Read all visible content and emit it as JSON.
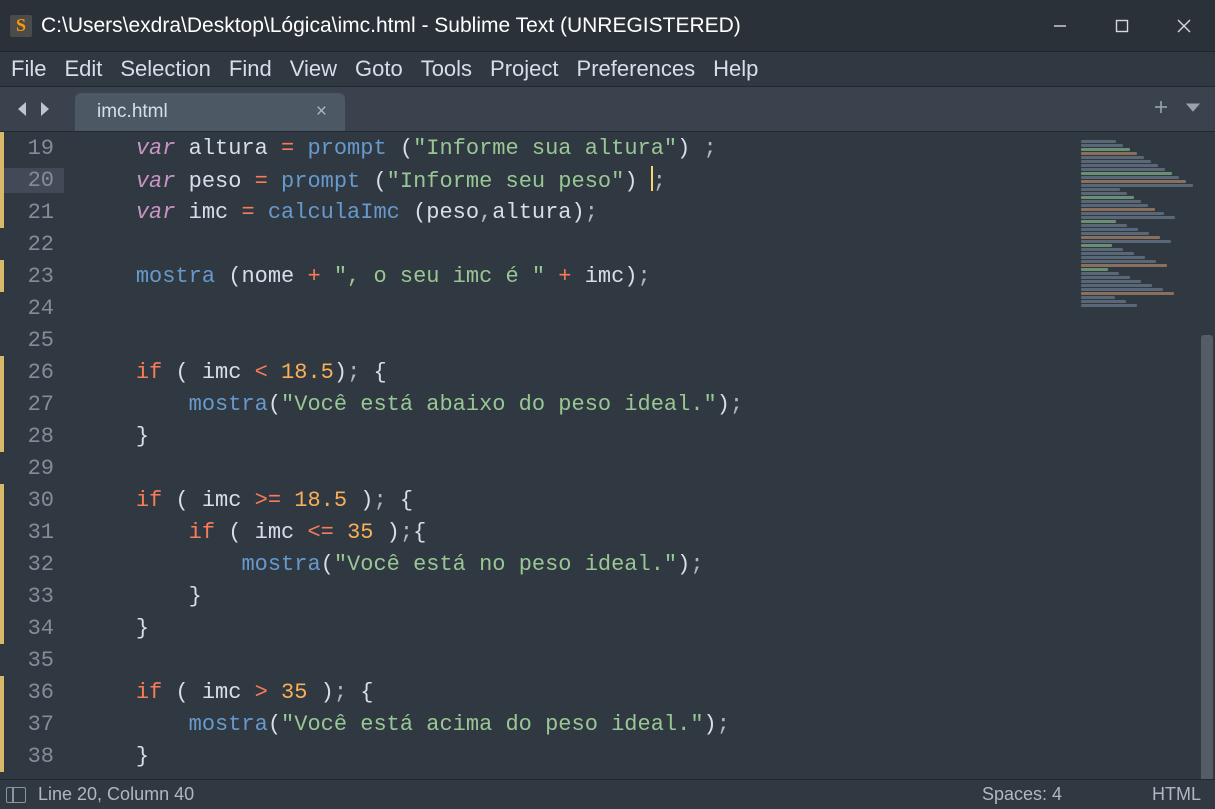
{
  "window": {
    "title": "C:\\Users\\exdra\\Desktop\\Lógica\\imc.html - Sublime Text (UNREGISTERED)"
  },
  "menu": {
    "items": [
      "File",
      "Edit",
      "Selection",
      "Find",
      "View",
      "Goto",
      "Tools",
      "Project",
      "Preferences",
      "Help"
    ]
  },
  "tab": {
    "name": "imc.html"
  },
  "status": {
    "position": "Line 20, Column 40",
    "spaces": "Spaces: 4",
    "syntax": "HTML"
  },
  "editor": {
    "first_line": 19,
    "highlighted_line": 20,
    "modified_lines": [
      19,
      20,
      21,
      23,
      26,
      27,
      28,
      30,
      31,
      32,
      33,
      34,
      36,
      37,
      38
    ],
    "fold_lines": [
      26,
      27,
      30,
      31,
      32,
      36,
      37
    ],
    "lines": [
      {
        "n": 19,
        "tokens": [
          {
            "t": "    ",
            "c": "var"
          },
          {
            "t": "var",
            "c": "kw"
          },
          {
            "t": " ",
            "c": "var"
          },
          {
            "t": "altura",
            "c": "var"
          },
          {
            "t": " ",
            "c": "var"
          },
          {
            "t": "=",
            "c": "op"
          },
          {
            "t": " ",
            "c": "var"
          },
          {
            "t": "prompt",
            "c": "fn"
          },
          {
            "t": " ",
            "c": "var"
          },
          {
            "t": "(",
            "c": "paren"
          },
          {
            "t": "\"Informe sua altura\"",
            "c": "str"
          },
          {
            "t": ")",
            "c": "paren"
          },
          {
            "t": " ;",
            "c": "punc"
          }
        ]
      },
      {
        "n": 20,
        "tokens": [
          {
            "t": "    ",
            "c": "var"
          },
          {
            "t": "var",
            "c": "kw"
          },
          {
            "t": " ",
            "c": "var"
          },
          {
            "t": "peso",
            "c": "var"
          },
          {
            "t": " ",
            "c": "var"
          },
          {
            "t": "=",
            "c": "op"
          },
          {
            "t": " ",
            "c": "var"
          },
          {
            "t": "prompt",
            "c": "fn"
          },
          {
            "t": " ",
            "c": "var"
          },
          {
            "t": "(",
            "c": "paren"
          },
          {
            "t": "\"Informe seu peso\"",
            "c": "str"
          },
          {
            "t": ")",
            "c": "paren"
          },
          {
            "t": " ",
            "c": "var"
          },
          {
            "t": "CURSOR",
            "c": "cursor"
          },
          {
            "t": ";",
            "c": "punc"
          }
        ]
      },
      {
        "n": 21,
        "tokens": [
          {
            "t": "    ",
            "c": "var"
          },
          {
            "t": "var",
            "c": "kw"
          },
          {
            "t": " ",
            "c": "var"
          },
          {
            "t": "imc",
            "c": "var"
          },
          {
            "t": " ",
            "c": "var"
          },
          {
            "t": "=",
            "c": "op"
          },
          {
            "t": " ",
            "c": "var"
          },
          {
            "t": "calculaImc",
            "c": "fn"
          },
          {
            "t": " ",
            "c": "var"
          },
          {
            "t": "(",
            "c": "paren"
          },
          {
            "t": "peso",
            "c": "var"
          },
          {
            "t": ",",
            "c": "punc"
          },
          {
            "t": "altura",
            "c": "var"
          },
          {
            "t": ")",
            "c": "paren"
          },
          {
            "t": ";",
            "c": "punc"
          }
        ]
      },
      {
        "n": 22,
        "tokens": []
      },
      {
        "n": 23,
        "tokens": [
          {
            "t": "    ",
            "c": "var"
          },
          {
            "t": "mostra",
            "c": "fn"
          },
          {
            "t": " ",
            "c": "var"
          },
          {
            "t": "(",
            "c": "paren"
          },
          {
            "t": "nome",
            "c": "var"
          },
          {
            "t": " ",
            "c": "var"
          },
          {
            "t": "+",
            "c": "op"
          },
          {
            "t": " ",
            "c": "var"
          },
          {
            "t": "\", o seu imc é \"",
            "c": "str"
          },
          {
            "t": " ",
            "c": "var"
          },
          {
            "t": "+",
            "c": "op"
          },
          {
            "t": " ",
            "c": "var"
          },
          {
            "t": "imc",
            "c": "var"
          },
          {
            "t": ")",
            "c": "paren"
          },
          {
            "t": ";",
            "c": "punc"
          }
        ]
      },
      {
        "n": 24,
        "tokens": [
          {
            "t": "",
            "c": "var"
          }
        ]
      },
      {
        "n": 25,
        "tokens": []
      },
      {
        "n": 26,
        "tokens": [
          {
            "t": "    ",
            "c": "var"
          },
          {
            "t": "if",
            "c": "op"
          },
          {
            "t": " ",
            "c": "var"
          },
          {
            "t": "(",
            "c": "paren"
          },
          {
            "t": " imc ",
            "c": "var"
          },
          {
            "t": "<",
            "c": "op"
          },
          {
            "t": " ",
            "c": "var"
          },
          {
            "t": "18.5",
            "c": "num"
          },
          {
            "t": ")",
            "c": "paren"
          },
          {
            "t": ";",
            "c": "punc"
          },
          {
            "t": " ",
            "c": "var"
          },
          {
            "t": "{",
            "c": "paren"
          }
        ]
      },
      {
        "n": 27,
        "tokens": [
          {
            "t": "        ",
            "c": "var"
          },
          {
            "t": "mostra",
            "c": "fn"
          },
          {
            "t": "(",
            "c": "paren"
          },
          {
            "t": "\"Você está abaixo do peso ideal.\"",
            "c": "str"
          },
          {
            "t": ")",
            "c": "paren"
          },
          {
            "t": ";",
            "c": "punc"
          }
        ]
      },
      {
        "n": 28,
        "tokens": [
          {
            "t": "    ",
            "c": "var"
          },
          {
            "t": "}",
            "c": "paren"
          }
        ]
      },
      {
        "n": 29,
        "tokens": []
      },
      {
        "n": 30,
        "tokens": [
          {
            "t": "    ",
            "c": "var"
          },
          {
            "t": "if",
            "c": "op"
          },
          {
            "t": " ",
            "c": "var"
          },
          {
            "t": "(",
            "c": "paren"
          },
          {
            "t": " imc ",
            "c": "var"
          },
          {
            "t": ">=",
            "c": "op"
          },
          {
            "t": " ",
            "c": "var"
          },
          {
            "t": "18.5",
            "c": "num"
          },
          {
            "t": " ",
            "c": "var"
          },
          {
            "t": ")",
            "c": "paren"
          },
          {
            "t": ";",
            "c": "punc"
          },
          {
            "t": " ",
            "c": "var"
          },
          {
            "t": "{",
            "c": "paren"
          }
        ]
      },
      {
        "n": 31,
        "tokens": [
          {
            "t": "        ",
            "c": "var"
          },
          {
            "t": "if",
            "c": "op"
          },
          {
            "t": " ",
            "c": "var"
          },
          {
            "t": "(",
            "c": "paren"
          },
          {
            "t": " imc ",
            "c": "var"
          },
          {
            "t": "<=",
            "c": "op"
          },
          {
            "t": " ",
            "c": "var"
          },
          {
            "t": "35",
            "c": "num"
          },
          {
            "t": " ",
            "c": "var"
          },
          {
            "t": ")",
            "c": "paren"
          },
          {
            "t": ";",
            "c": "punc"
          },
          {
            "t": "{",
            "c": "paren"
          }
        ]
      },
      {
        "n": 32,
        "tokens": [
          {
            "t": "            ",
            "c": "var"
          },
          {
            "t": "mostra",
            "c": "fn"
          },
          {
            "t": "(",
            "c": "paren"
          },
          {
            "t": "\"Você está no peso ideal.\"",
            "c": "str"
          },
          {
            "t": ")",
            "c": "paren"
          },
          {
            "t": ";",
            "c": "punc"
          }
        ]
      },
      {
        "n": 33,
        "tokens": [
          {
            "t": "        ",
            "c": "var"
          },
          {
            "t": "}",
            "c": "paren"
          }
        ]
      },
      {
        "n": 34,
        "tokens": [
          {
            "t": "    ",
            "c": "var"
          },
          {
            "t": "}",
            "c": "paren"
          }
        ]
      },
      {
        "n": 35,
        "tokens": []
      },
      {
        "n": 36,
        "tokens": [
          {
            "t": "    ",
            "c": "var"
          },
          {
            "t": "if",
            "c": "op"
          },
          {
            "t": " ",
            "c": "var"
          },
          {
            "t": "(",
            "c": "paren"
          },
          {
            "t": " imc ",
            "c": "var"
          },
          {
            "t": ">",
            "c": "op"
          },
          {
            "t": " ",
            "c": "var"
          },
          {
            "t": "35",
            "c": "num"
          },
          {
            "t": " ",
            "c": "var"
          },
          {
            "t": ")",
            "c": "paren"
          },
          {
            "t": ";",
            "c": "punc"
          },
          {
            "t": " ",
            "c": "var"
          },
          {
            "t": "{",
            "c": "paren"
          }
        ]
      },
      {
        "n": 37,
        "tokens": [
          {
            "t": "        ",
            "c": "var"
          },
          {
            "t": "mostra",
            "c": "fn"
          },
          {
            "t": "(",
            "c": "paren"
          },
          {
            "t": "\"Você está acima do peso ideal.\"",
            "c": "str"
          },
          {
            "t": ")",
            "c": "paren"
          },
          {
            "t": ";",
            "c": "punc"
          }
        ]
      },
      {
        "n": 38,
        "tokens": [
          {
            "t": "    ",
            "c": "var"
          },
          {
            "t": "}",
            "c": "paren"
          }
        ]
      }
    ]
  }
}
